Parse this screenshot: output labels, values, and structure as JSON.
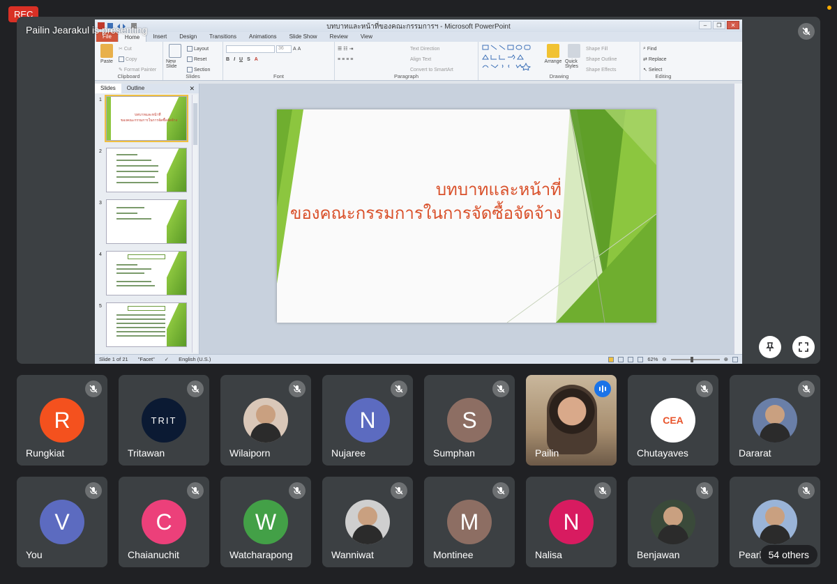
{
  "recording": {
    "label": "REC"
  },
  "presentation": {
    "presenter_text": "Pailin Jearakul is presenting",
    "window_title": "บทบาทและหน้าที่ของคณะกรรมการฯ - Microsoft PowerPoint",
    "ribbon_tabs": [
      "File",
      "Home",
      "Insert",
      "Design",
      "Transitions",
      "Animations",
      "Slide Show",
      "Review",
      "View"
    ],
    "ribbon": {
      "clipboard": {
        "paste": "Paste",
        "cut": "Cut",
        "copy": "Copy",
        "format_painter": "Format Painter",
        "group": "Clipboard"
      },
      "slides": {
        "new_slide": "New Slide",
        "layout": "Layout",
        "reset": "Reset",
        "section": "Section",
        "group": "Slides"
      },
      "font": {
        "size": "36",
        "group": "Font"
      },
      "paragraph": {
        "text_direction": "Text Direction",
        "align_text": "Align Text",
        "smartart": "Convert to SmartArt",
        "group": "Paragraph"
      },
      "drawing": {
        "arrange": "Arrange",
        "quick_styles": "Quick Styles",
        "shape_fill": "Shape Fill",
        "shape_outline": "Shape Outline",
        "shape_effects": "Shape Effects",
        "group": "Drawing"
      },
      "editing": {
        "find": "Find",
        "replace": "Replace",
        "select": "Select",
        "group": "Editing"
      }
    },
    "pane_tabs": [
      "Slides",
      "Outline"
    ],
    "thumbnail_numbers": [
      "1",
      "2",
      "3",
      "4",
      "5"
    ],
    "slide_title_line1": "บทบาทและหน้าที่",
    "slide_title_line2": "ของคณะกรรมการในการจัดซื้อจัดจ้าง",
    "status": {
      "slide_info": "Slide 1 of 21",
      "theme": "\"Facet\"",
      "language": "English (U.S.)",
      "zoom": "62%"
    }
  },
  "participants": [
    {
      "name": "Rungkiat",
      "initial": "R",
      "color": "#f4511e",
      "type": "letter",
      "muted": true
    },
    {
      "name": "Tritawan",
      "initial": "TRIT",
      "color": "#0b1a33",
      "type": "logo",
      "muted": true
    },
    {
      "name": "Wilaiporn",
      "initial": "",
      "color": "#d9c7b8",
      "type": "photo",
      "muted": true
    },
    {
      "name": "Nujaree",
      "initial": "N",
      "color": "#5c6bc0",
      "type": "letter",
      "muted": true
    },
    {
      "name": "Sumphan",
      "initial": "S",
      "color": "#8d6e63",
      "type": "letter",
      "muted": true
    },
    {
      "name": "Pailin",
      "initial": "",
      "color": "#b89a7a",
      "type": "video",
      "muted": false
    },
    {
      "name": "Chutayaves",
      "initial": "CEA",
      "color": "#ffffff",
      "type": "logo-light",
      "muted": true
    },
    {
      "name": "Dararat",
      "initial": "",
      "color": "#6a7fa8",
      "type": "photo",
      "muted": true
    },
    {
      "name": "You",
      "initial": "V",
      "color": "#5c6bc0",
      "type": "letter",
      "muted": true
    },
    {
      "name": "Chaianuchit",
      "initial": "C",
      "color": "#ec407a",
      "type": "letter",
      "muted": true
    },
    {
      "name": "Watcharapong",
      "initial": "W",
      "color": "#43a047",
      "type": "letter",
      "muted": true
    },
    {
      "name": "Wanniwat",
      "initial": "",
      "color": "#cfcfcf",
      "type": "photo",
      "muted": true
    },
    {
      "name": "Montinee",
      "initial": "M",
      "color": "#8d6e63",
      "type": "letter",
      "muted": true
    },
    {
      "name": "Nalisa",
      "initial": "N",
      "color": "#d81b60",
      "type": "letter",
      "muted": true
    },
    {
      "name": "Benjawan",
      "initial": "",
      "color": "#3a4a3a",
      "type": "photo",
      "muted": true
    },
    {
      "name": "Pearl",
      "initial": "",
      "color": "#9ab4d8",
      "type": "photo",
      "muted": true
    }
  ],
  "others": {
    "label": "54 others"
  }
}
